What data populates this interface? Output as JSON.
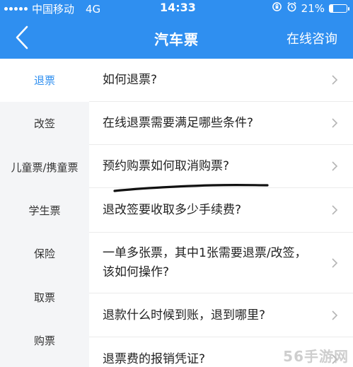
{
  "status_bar": {
    "carrier": "中国移动",
    "network": "4G",
    "time": "14:33",
    "battery": "21%",
    "battery_level": 0.21
  },
  "navbar": {
    "title": "汽车票",
    "action_label": "在线咨询",
    "back_icon": "chevron-left-icon"
  },
  "sidebar": {
    "items": [
      {
        "label": "退票",
        "active": true
      },
      {
        "label": "改签"
      },
      {
        "label": "儿童票/携童票"
      },
      {
        "label": "学生票"
      },
      {
        "label": "保险"
      },
      {
        "label": "取票"
      },
      {
        "label": "购票"
      }
    ]
  },
  "questions": [
    {
      "text": "如何退票?"
    },
    {
      "text": "在线退票需要满足哪些条件?"
    },
    {
      "text": "预约购票如何取消购票?"
    },
    {
      "text": "退改签要收取多少手续费?"
    },
    {
      "text": "一单多张票，其中1张需要退票/改签，该如何操作?"
    },
    {
      "text": "退款什么时候到账，退到哪里?"
    },
    {
      "text": "退票费的报销凭证?"
    }
  ],
  "watermark": "56手游网",
  "colors": {
    "primary": "#2f8ff0",
    "sidebar_bg": "#f4f5f7",
    "divider": "#ebebeb"
  }
}
